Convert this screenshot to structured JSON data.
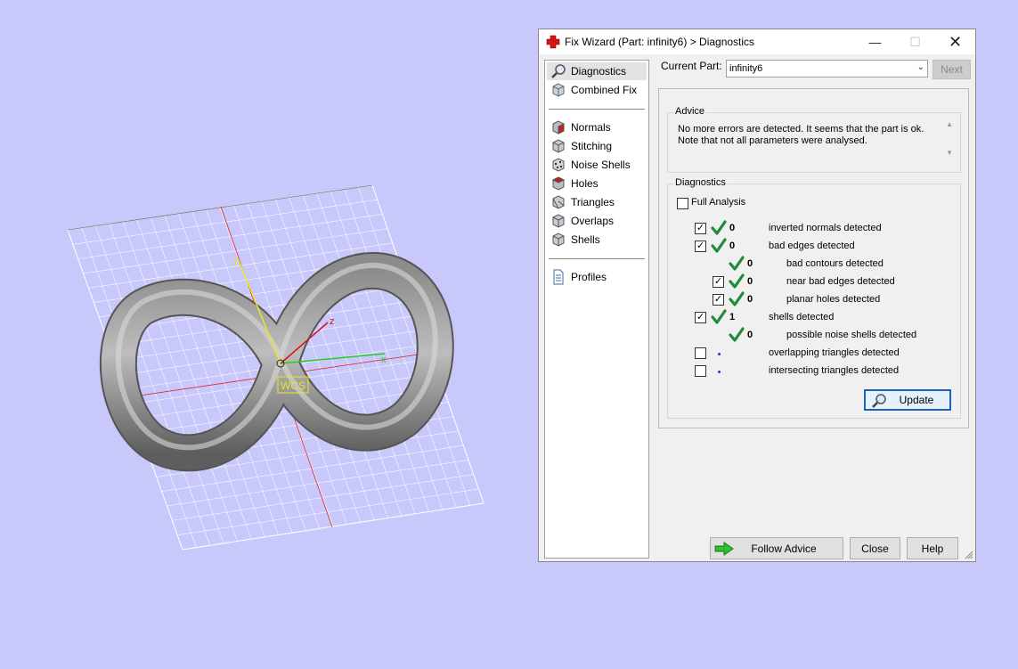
{
  "window": {
    "title": "Fix Wizard (Part: infinity6) > Diagnostics",
    "controls": [
      "minimize",
      "maximize",
      "close"
    ]
  },
  "viewport": {
    "wcs_label": "WCS",
    "axes": [
      "x",
      "y",
      "z"
    ]
  },
  "nav": {
    "items": [
      {
        "label": "Diagnostics",
        "icon": "magnifier-icon",
        "selected": true
      },
      {
        "label": "Combined Fix",
        "icon": "cube-icon"
      },
      {
        "label": "Normals",
        "icon": "normals-cube-icon"
      },
      {
        "label": "Stitching",
        "icon": "stitching-cube-icon"
      },
      {
        "label": "Noise Shells",
        "icon": "noise-shells-icon"
      },
      {
        "label": "Holes",
        "icon": "holes-cube-icon"
      },
      {
        "label": "Triangles",
        "icon": "triangles-cube-icon"
      },
      {
        "label": "Overlaps",
        "icon": "overlaps-cube-icon"
      },
      {
        "label": "Shells",
        "icon": "shells-cube-icon"
      },
      {
        "label": "Profiles",
        "icon": "document-icon"
      }
    ]
  },
  "top": {
    "current_part_label": "Current Part:",
    "current_part_value": "infinity6",
    "next_label": "Next"
  },
  "advice": {
    "title": "Advice",
    "text_line1": "No more errors are detected. It seems that the part is ok.",
    "text_line2": "Note that not all parameters were analysed."
  },
  "diagnostics": {
    "title": "Diagnostics",
    "full_analysis_label": "Full Analysis",
    "full_analysis_checked": false,
    "rows": [
      {
        "label": "inverted normals detected",
        "count": "0",
        "checkbox": true,
        "checked": true,
        "status": "ok",
        "indent": 0
      },
      {
        "label": "bad edges detected",
        "count": "0",
        "checkbox": true,
        "checked": true,
        "status": "ok",
        "indent": 0
      },
      {
        "label": "bad contours detected",
        "count": "0",
        "checkbox": false,
        "checked": false,
        "status": "ok",
        "indent": 1
      },
      {
        "label": "near bad edges detected",
        "count": "0",
        "checkbox": true,
        "checked": true,
        "status": "ok",
        "indent": 1
      },
      {
        "label": "planar holes detected",
        "count": "0",
        "checkbox": true,
        "checked": true,
        "status": "ok",
        "indent": 1
      },
      {
        "label": "shells detected",
        "count": "1",
        "checkbox": true,
        "checked": true,
        "status": "ok",
        "indent": 0
      },
      {
        "label": "possible noise shells detected",
        "count": "0",
        "checkbox": false,
        "checked": false,
        "status": "ok",
        "indent": 1
      },
      {
        "label": "overlapping triangles detected",
        "count": "",
        "checkbox": true,
        "checked": false,
        "status": "unknown",
        "indent": 0
      },
      {
        "label": "intersecting triangles detected",
        "count": "",
        "checkbox": true,
        "checked": false,
        "status": "unknown",
        "indent": 0
      }
    ],
    "update_label": "Update"
  },
  "footer": {
    "follow_advice_label": "Follow Advice",
    "close_label": "Close",
    "help_label": "Help"
  },
  "colors": {
    "background": "#c8c8fa",
    "check_green": "#1e8a3a",
    "axis_x": "#22cc22",
    "axis_y": "#e8e820",
    "axis_z": "#dd1111"
  }
}
